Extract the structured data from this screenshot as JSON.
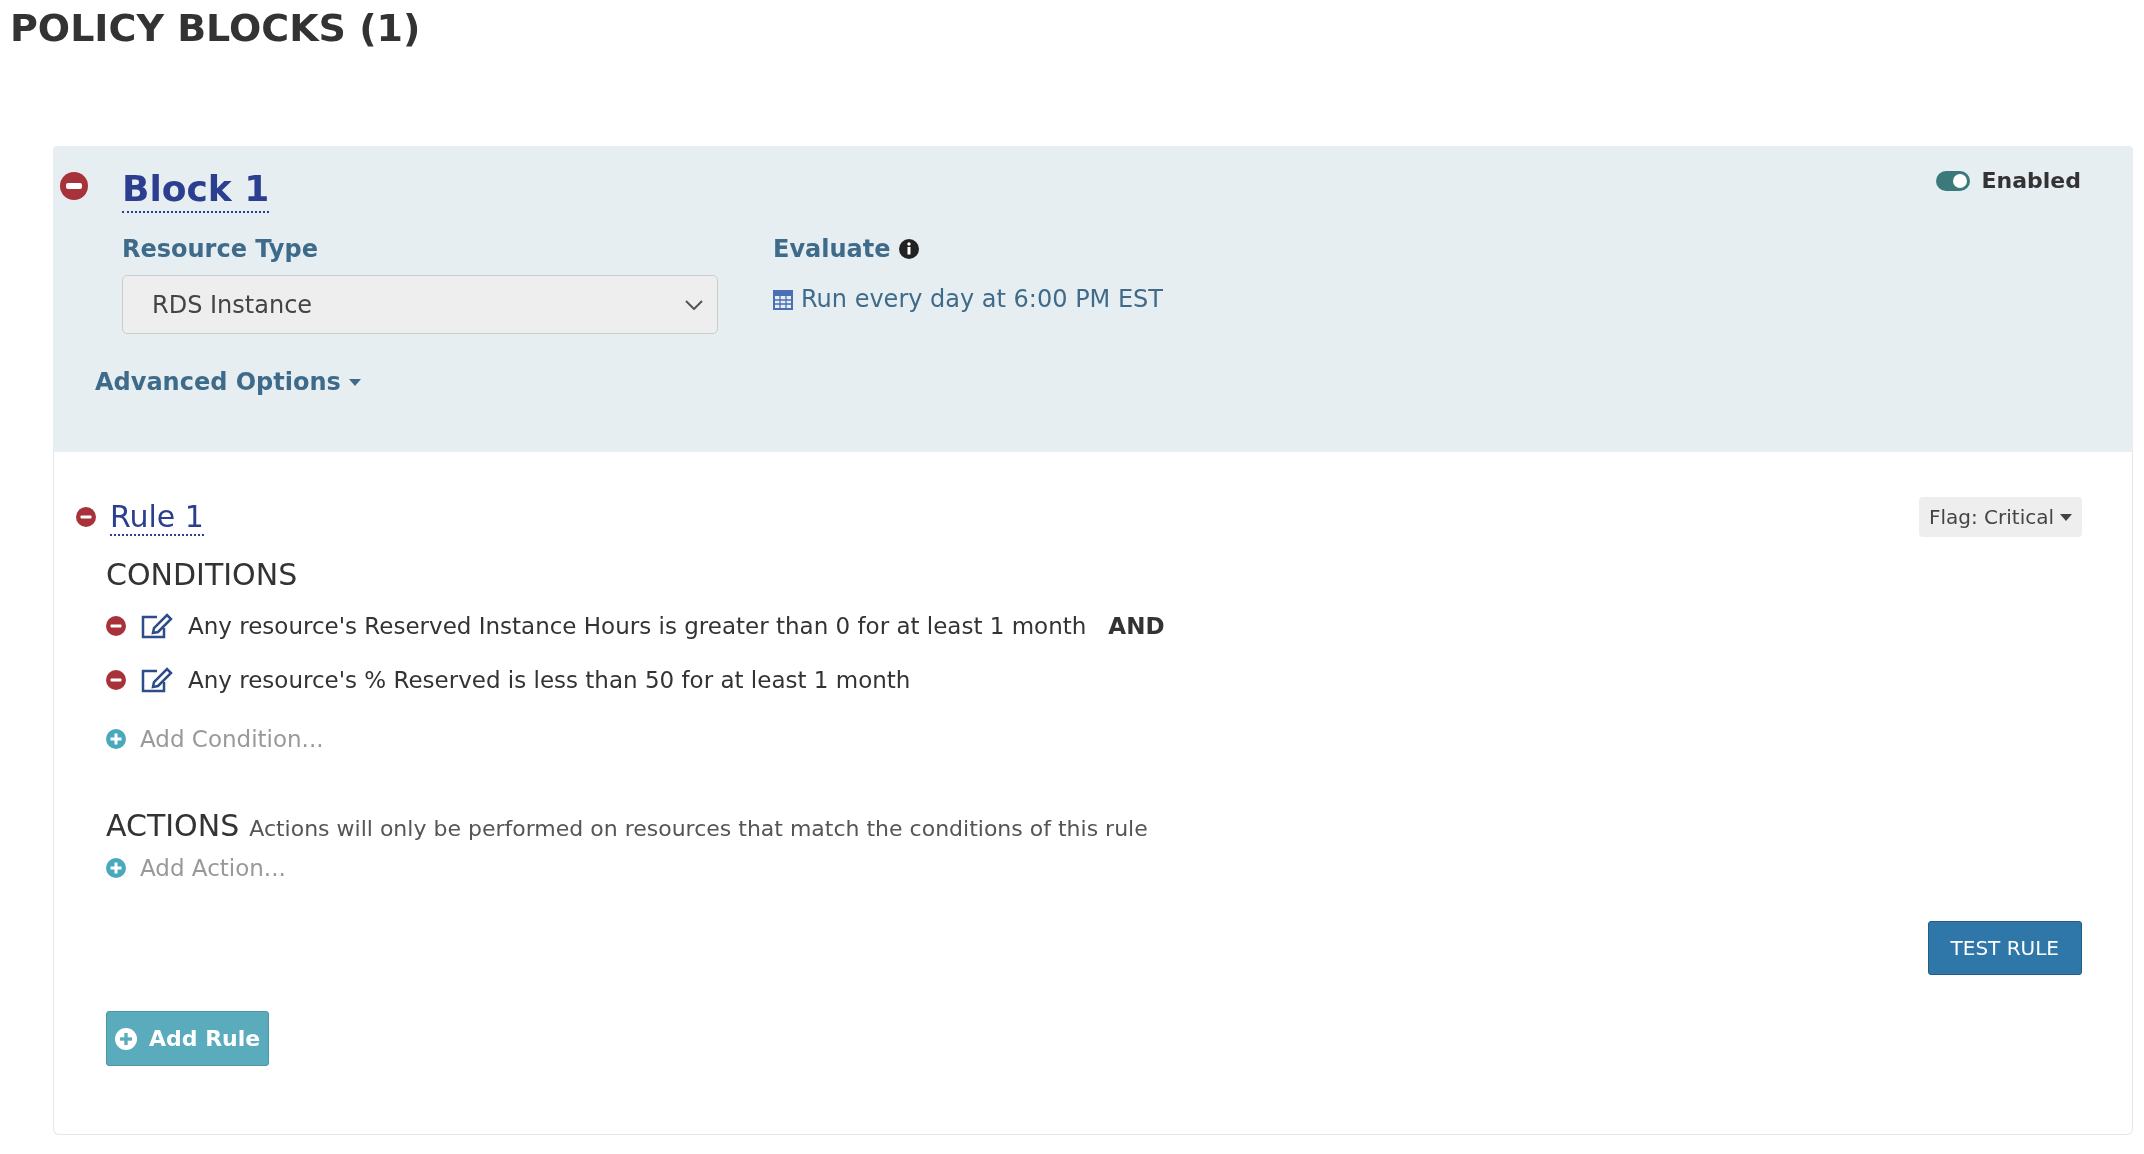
{
  "page_title": "POLICY BLOCKS (1)",
  "block": {
    "title": "Block 1",
    "enabled": true,
    "enabled_label": "Enabled",
    "resource_type": {
      "label": "Resource Type",
      "value": "RDS Instance"
    },
    "evaluate": {
      "label": "Evaluate",
      "schedule": "Run every day at 6:00 PM EST"
    },
    "advanced_options": "Advanced Options",
    "rules": [
      {
        "title": "Rule 1",
        "flag": "Flag: Critical",
        "conditions_heading": "CONDITIONS",
        "conditions": [
          {
            "text": "Any resource's Reserved Instance Hours is greater than 0 for at least 1 month",
            "conjunction": "AND"
          },
          {
            "text": "Any resource's % Reserved is less than 50 for at least 1 month"
          }
        ],
        "add_condition": "Add Condition...",
        "actions_heading": "ACTIONS",
        "actions_note": "Actions will only be performed on resources that match the conditions of this rule",
        "add_action": "Add Action...",
        "test_button": "TEST RULE"
      }
    ],
    "add_rule": "Add Rule"
  }
}
